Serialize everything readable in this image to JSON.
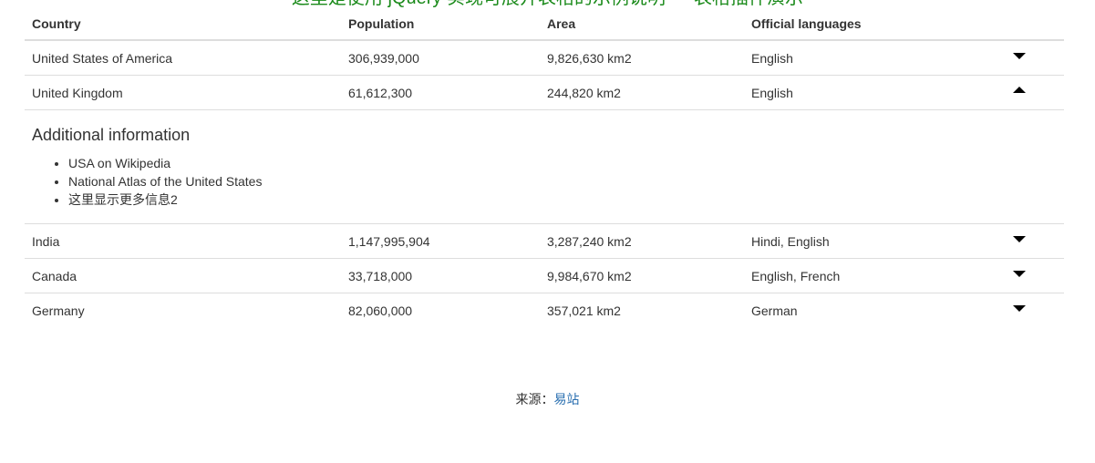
{
  "top_title": "这里是使用 jQuery 实现可展开表格的示例说明 — 表格插件演示",
  "table": {
    "headers": [
      "Country",
      "Population",
      "Area",
      "Official languages"
    ],
    "rows": [
      {
        "country": "United States of America",
        "population": "306,939,000",
        "area": "9,826,630 km2",
        "languages": "English",
        "expanded": false
      },
      {
        "country": "United Kingdom",
        "population": "61,612,300",
        "area": "244,820 km2",
        "languages": "English",
        "expanded": true
      },
      {
        "country": "India",
        "population": "1,147,995,904",
        "area": "3,287,240 km2",
        "languages": "Hindi, English",
        "expanded": false
      },
      {
        "country": "Canada",
        "population": "33,718,000",
        "area": "9,984,670 km2",
        "languages": "English, French",
        "expanded": false
      },
      {
        "country": "Germany",
        "population": "82,060,000",
        "area": "357,021 km2",
        "languages": "German",
        "expanded": false
      }
    ],
    "detail": {
      "title": "Additional information",
      "items": [
        "USA on Wikipedia",
        "National Atlas of the United States",
        "这里显示更多信息2"
      ]
    }
  },
  "footer": {
    "label": "来源：",
    "link": "易站"
  }
}
